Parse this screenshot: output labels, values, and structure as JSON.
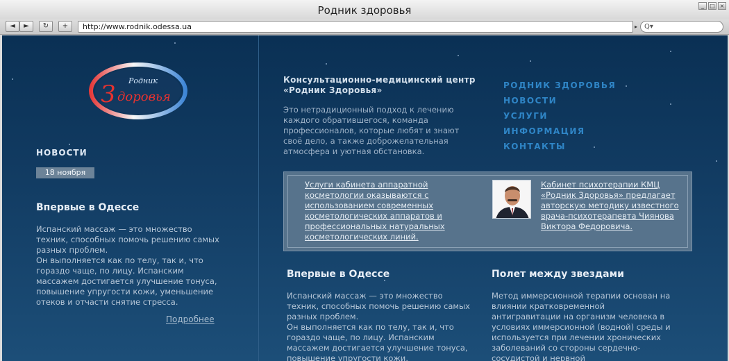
{
  "window": {
    "title": "Родник здоровья"
  },
  "toolbar": {
    "back_label": "◄",
    "forward_label": "►",
    "reload_label": "↻",
    "add_label": "+",
    "url": "http://www.rodnik.odessa.ua",
    "search_label": "Q▾"
  },
  "logo": {
    "small_text": "Родник",
    "big_letter": "З",
    "rest_text": "доровья"
  },
  "left": {
    "heading": "НОВОСТИ",
    "date": "18 ноября",
    "title": "Впервые в Одессе",
    "body": [
      "Испанский массаж — это множество техник, способных помочь решению самых разных проблем.",
      "Он выполняется как по телу, так и, что гораздо чаще, по лицу. Испанским массажем достигается улучшение тонуса, повышение упругости кожи, уменьшение отеков и отчасти снятие стресса."
    ],
    "more": "Подробнее"
  },
  "intro": {
    "title": "Консультационно-медицинский центр «Родник Здоровья»",
    "body": "Это нетрадиционный подход к лечению каждого обратившегося, команда профессионалов, которые любят и знают своё дело, а также доброжелательная атмосфера и уютная обстановка."
  },
  "nav": [
    "РОДНИК ЗДОРОВЬЯ",
    "НОВОСТИ",
    "УСЛУГИ",
    "ИНФОРМАЦИЯ",
    "КОНТАКТЫ"
  ],
  "promo": {
    "left_text": "Услуги кабинета аппаратной косметологии оказываются с использованием современных косметологических аппаратов и профессиональных натуральных косметологических линий.",
    "right_text": "Кабинет психотерапии КМЦ «Родник Здоровья» предлагает авторскую методику известного врача-психотерапевта Чиянова Виктора Федоровича."
  },
  "articles": [
    {
      "title": "Впервые в Одессе",
      "body": [
        "Испанский массаж — это множество техник, способных помочь решению самых разных проблем.",
        "Он выполняется как по телу, так и, что гораздо чаще, по лицу. Испанским массажем достигается улучшение тонуса, повышение упругости кожи,"
      ]
    },
    {
      "title": "Полет между звездами",
      "body": [
        "Метод иммерсионной терапии основан на влиянии кратковременной антигравитации на организм человека в условиях иммерсионной (водной) среды и используется при лечении хронических заболеваний со стороны сердечно-сосудистой и нервной"
      ]
    }
  ],
  "colors": {
    "page_bg": "#0a3054",
    "nav_link": "#2f85c6",
    "promo_bg": "#57738c"
  }
}
